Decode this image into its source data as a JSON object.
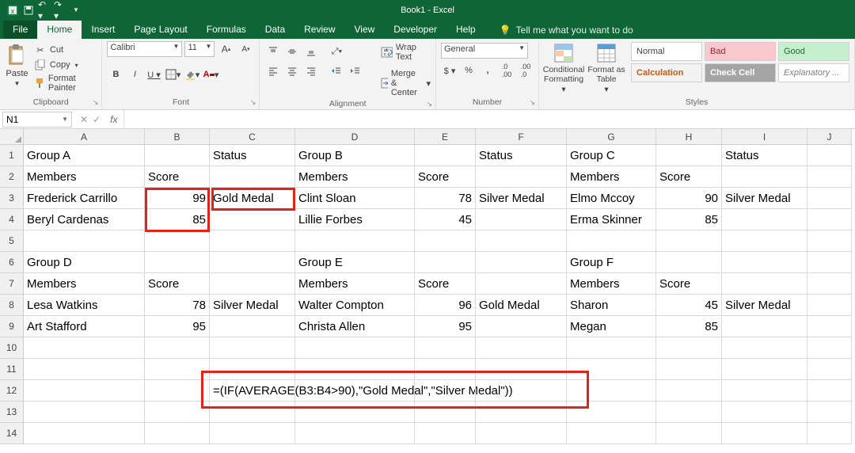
{
  "app": {
    "title": "Book1 - Excel"
  },
  "qat": {
    "save": "save-icon",
    "undo": "undo-icon",
    "redo": "redo-icon"
  },
  "tabs": [
    "File",
    "Home",
    "Insert",
    "Page Layout",
    "Formulas",
    "Data",
    "Review",
    "View",
    "Developer",
    "Help"
  ],
  "active_tab": "Home",
  "tell_me": "Tell me what you want to do",
  "clipboard": {
    "paste": "Paste",
    "cut": "Cut",
    "copy": "Copy",
    "painter": "Format Painter",
    "label": "Clipboard"
  },
  "font": {
    "name": "Calibri",
    "size": "11",
    "label": "Font"
  },
  "alignment": {
    "wrap": "Wrap Text",
    "merge": "Merge & Center",
    "label": "Alignment"
  },
  "number": {
    "format": "General",
    "label": "Number"
  },
  "styles": {
    "cond": "Conditional Formatting",
    "fmt_table": "Format as Table",
    "gallery": [
      "Normal",
      "Bad",
      "Good",
      "Calculation",
      "Check Cell",
      "Explanatory ..."
    ],
    "label": "Styles"
  },
  "namebox": "N1",
  "formula_input": "",
  "columns": [
    "A",
    "B",
    "C",
    "D",
    "E",
    "F",
    "G",
    "H",
    "I",
    "J"
  ],
  "rows_shown": [
    "1",
    "2",
    "3",
    "4",
    "5",
    "6",
    "7",
    "8",
    "9",
    "10",
    "11",
    "12",
    "13",
    "14"
  ],
  "cells": {
    "r1": {
      "A": "Group A",
      "C": "Status",
      "D": "Group B",
      "F": "Status",
      "G": "Group C",
      "I": "Status"
    },
    "r2": {
      "A": "Members",
      "B": "Score",
      "D": "Members",
      "E": "Score",
      "G": "Members",
      "H": "Score"
    },
    "r3": {
      "A": "Frederick Carrillo",
      "B": "99",
      "C": "Gold Medal",
      "D": "Clint Sloan",
      "E": "78",
      "F": "Silver Medal",
      "G": "Elmo Mccoy",
      "H": "90",
      "I": "Silver Medal"
    },
    "r4": {
      "A": "Beryl Cardenas",
      "B": "85",
      "D": "Lillie Forbes",
      "E": "45",
      "G": "Erma Skinner",
      "H": "85"
    },
    "r6": {
      "A": "Group D",
      "D": "Group E",
      "G": "Group F"
    },
    "r7": {
      "A": "Members",
      "B": "Score",
      "D": "Members",
      "E": "Score",
      "G": "Members",
      "H": "Score"
    },
    "r8": {
      "A": "Lesa Watkins",
      "B": "78",
      "C": "Silver Medal",
      "D": "Walter Compton",
      "E": "96",
      "F": "Gold Medal",
      "G": "Sharon",
      "H": "45",
      "I": "Silver Medal"
    },
    "r9": {
      "A": "Art Stafford",
      "B": "95",
      "D": "Christa Allen",
      "E": "95",
      "G": "Megan",
      "H": "85"
    },
    "r12": {
      "C": "=(IF(AVERAGE(B3:B4>90),\"Gold Medal\",\"Silver Medal\"))"
    }
  },
  "chart_data": {
    "type": "table",
    "note": "Spreadsheet data grouped by teams with member scores and medal status",
    "groups": [
      {
        "name": "Group A",
        "members": [
          {
            "name": "Frederick Carrillo",
            "score": 99
          },
          {
            "name": "Beryl Cardenas",
            "score": 85
          }
        ],
        "status": "Gold Medal"
      },
      {
        "name": "Group B",
        "members": [
          {
            "name": "Clint Sloan",
            "score": 78
          },
          {
            "name": "Lillie Forbes",
            "score": 45
          }
        ],
        "status": "Silver Medal"
      },
      {
        "name": "Group C",
        "members": [
          {
            "name": "Elmo Mccoy",
            "score": 90
          },
          {
            "name": "Erma Skinner",
            "score": 85
          }
        ],
        "status": "Silver Medal"
      },
      {
        "name": "Group D",
        "members": [
          {
            "name": "Lesa Watkins",
            "score": 78
          },
          {
            "name": "Art Stafford",
            "score": 95
          }
        ],
        "status": "Silver Medal"
      },
      {
        "name": "Group E",
        "members": [
          {
            "name": "Walter Compton",
            "score": 96
          },
          {
            "name": "Christa Allen",
            "score": 95
          }
        ],
        "status": "Gold Medal"
      },
      {
        "name": "Group F",
        "members": [
          {
            "name": "Sharon",
            "score": 45
          },
          {
            "name": "Megan",
            "score": 85
          }
        ],
        "status": "Silver Medal"
      }
    ],
    "formula_shown": "=(IF(AVERAGE(B3:B4>90),\"Gold Medal\",\"Silver Medal\"))"
  }
}
